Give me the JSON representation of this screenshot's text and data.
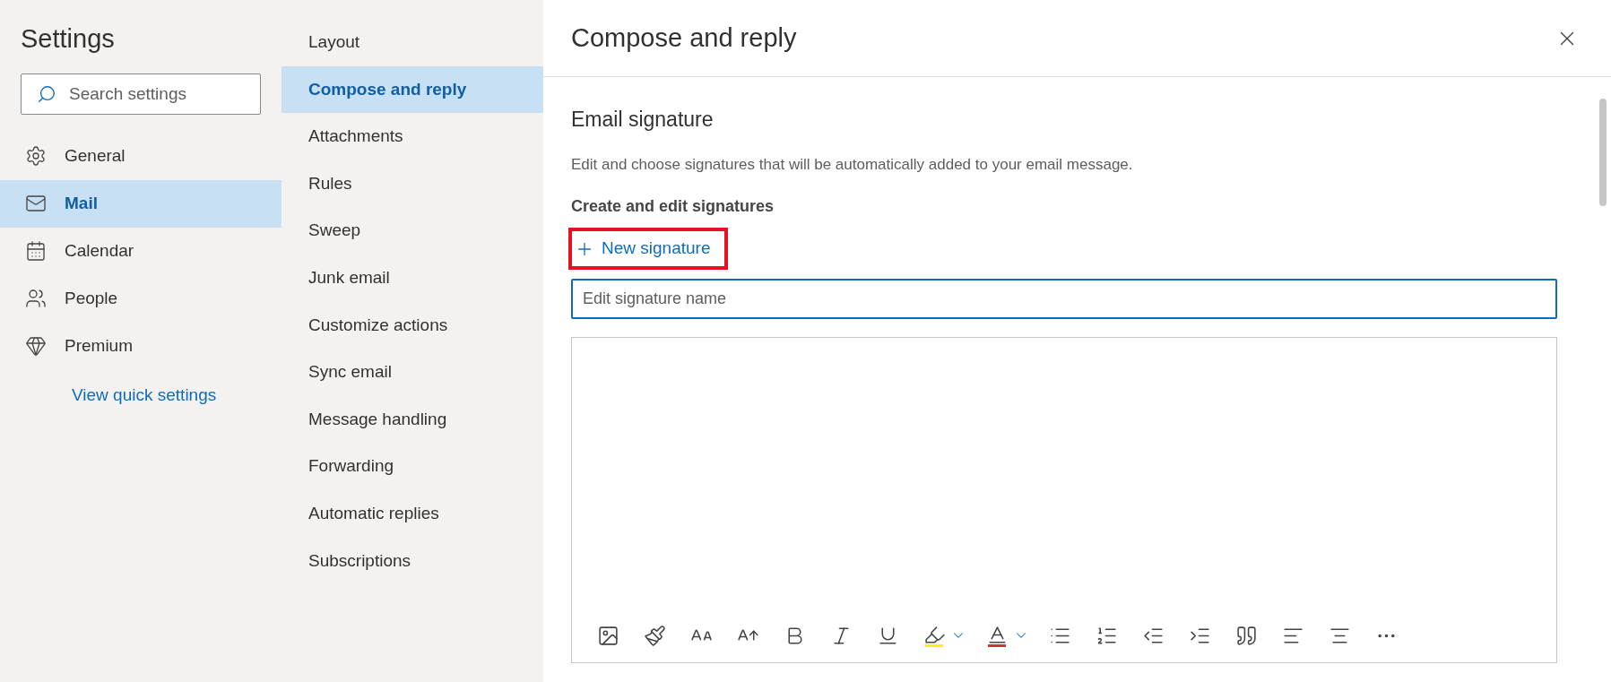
{
  "sidebar": {
    "title": "Settings",
    "search": {
      "placeholder": "Search settings"
    },
    "items": [
      {
        "label": "General",
        "selected": false
      },
      {
        "label": "Mail",
        "selected": true
      },
      {
        "label": "Calendar",
        "selected": false
      },
      {
        "label": "People",
        "selected": false
      },
      {
        "label": "Premium",
        "selected": false
      }
    ],
    "link": "View quick settings"
  },
  "subnav": {
    "items": [
      {
        "label": "Layout",
        "selected": false
      },
      {
        "label": "Compose and reply",
        "selected": true
      },
      {
        "label": "Attachments",
        "selected": false
      },
      {
        "label": "Rules",
        "selected": false
      },
      {
        "label": "Sweep",
        "selected": false
      },
      {
        "label": "Junk email",
        "selected": false
      },
      {
        "label": "Customize actions",
        "selected": false
      },
      {
        "label": "Sync email",
        "selected": false
      },
      {
        "label": "Message handling",
        "selected": false
      },
      {
        "label": "Forwarding",
        "selected": false
      },
      {
        "label": "Automatic replies",
        "selected": false
      },
      {
        "label": "Subscriptions",
        "selected": false
      }
    ]
  },
  "panel": {
    "title": "Compose and reply",
    "section_title": "Email signature",
    "description": "Edit and choose signatures that will be automatically added to your email message.",
    "subheading": "Create and edit signatures",
    "new_button": {
      "label": "New signature",
      "highlighted": true
    },
    "name_field": {
      "placeholder": "Edit signature name"
    }
  }
}
